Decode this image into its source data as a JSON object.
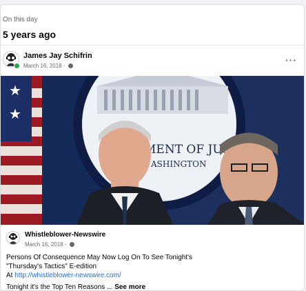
{
  "memory": {
    "label": "On this day",
    "title": "5 years ago"
  },
  "post": {
    "author": "James Jay Schifrin",
    "date": "March 16, 2018 ·",
    "more_label": "···",
    "photo_caption_text": "MENT OF JUSTI",
    "photo_subcaption_text": "ASHINGTON"
  },
  "shared": {
    "author": "Whistleblower-Newswire",
    "date": "March 16, 2018 ·",
    "line1": "Persons Of Consequence May Now Log On To See Tonight's",
    "line2": "\"Thursday's Tactics\" E-edition",
    "at_label": "At ",
    "link": "http://whistleblower-newswire.com/",
    "tonight": "Tonight it's the Top Ten Reasons ... ",
    "see_more": "See more"
  },
  "colors": {
    "link": "#216fdb",
    "online": "#31a24c",
    "muted": "#65676b"
  },
  "icons": [
    "globe-icon",
    "more-options-icon",
    "avatar-icon"
  ]
}
